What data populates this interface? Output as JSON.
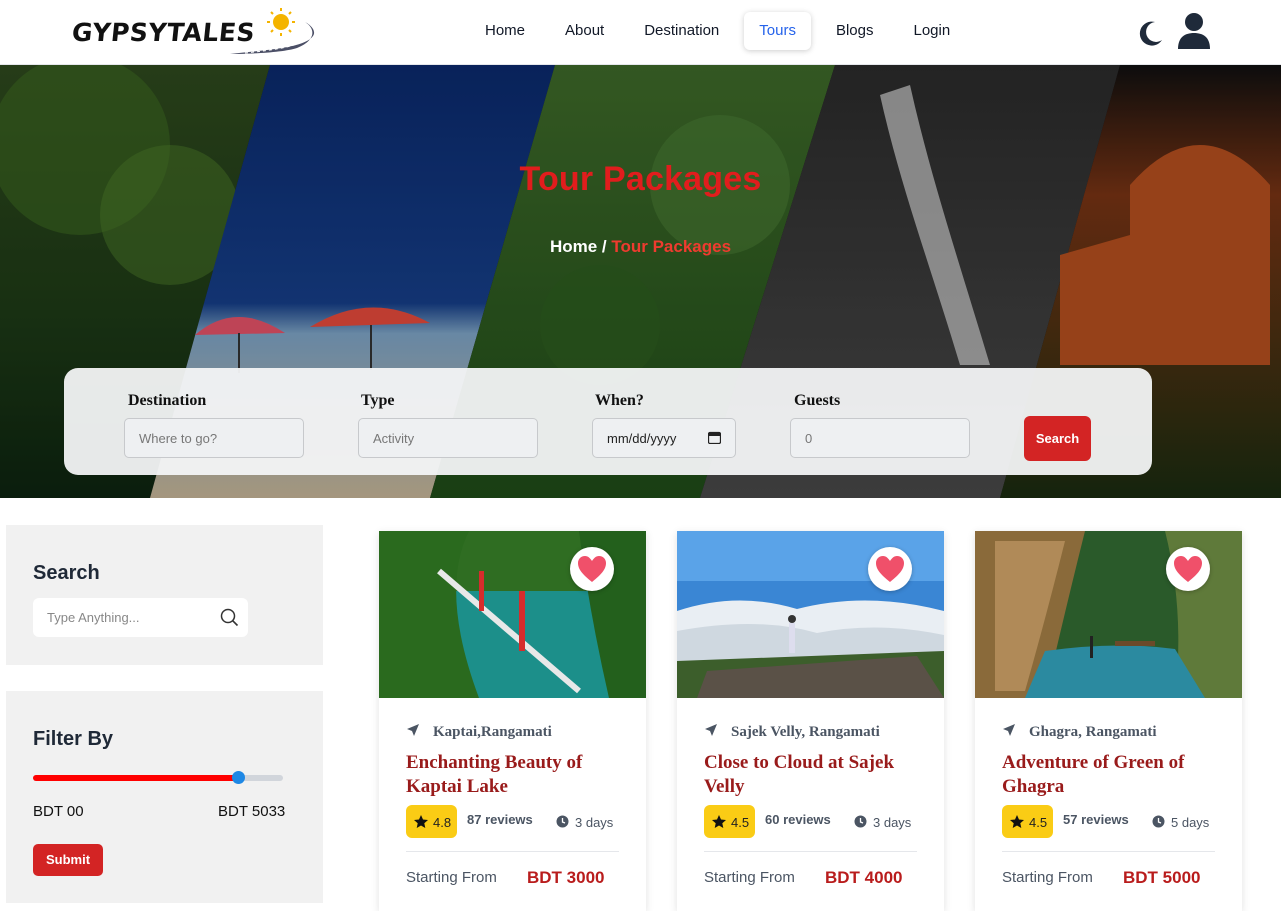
{
  "brand": {
    "name": "GYPSYTALES"
  },
  "nav": {
    "items": [
      {
        "label": "Home",
        "active": false
      },
      {
        "label": "About",
        "active": false
      },
      {
        "label": "Destination",
        "active": false
      },
      {
        "label": "Tours",
        "active": true
      },
      {
        "label": "Blogs",
        "active": false
      },
      {
        "label": "Login",
        "active": false
      }
    ],
    "icons": [
      "moon-icon",
      "user-icon"
    ]
  },
  "hero": {
    "title": "Tour Packages",
    "breadcrumb": {
      "home": "Home",
      "separator": " / ",
      "current": "Tour Packages"
    }
  },
  "search_form": {
    "destination": {
      "label": "Destination",
      "placeholder": "Where to go?"
    },
    "type": {
      "label": "Type",
      "placeholder": "Activity"
    },
    "when": {
      "label": "When?",
      "placeholder": "mm/dd/yyyy"
    },
    "guests": {
      "label": "Guests",
      "placeholder": "0"
    },
    "submit_label": "Search"
  },
  "sidebar": {
    "search": {
      "title": "Search",
      "placeholder": "Type Anything..."
    },
    "filter": {
      "title": "Filter By",
      "min_label": "BDT 00",
      "max_label": "BDT 5033",
      "slider_fraction": 0.82,
      "submit_label": "Submit"
    }
  },
  "tours": [
    {
      "location": "Kaptai,Rangamati",
      "title": "Enchanting Beauty of Kaptai Lake",
      "rating": "4.8",
      "reviews": "87 reviews",
      "duration": "3 days",
      "from_label": "Starting From",
      "price": "BDT 3000"
    },
    {
      "location": "Sajek Velly, Rangamati",
      "title": "Close to Cloud at Sajek Velly",
      "rating": "4.5",
      "reviews": "60 reviews",
      "duration": "3 days",
      "from_label": "Starting From",
      "price": "BDT 4000"
    },
    {
      "location": "Ghagra, Rangamati",
      "title": "Adventure of Green of Ghagra",
      "rating": "4.5",
      "reviews": "57 reviews",
      "duration": "5 days",
      "from_label": "Starting From",
      "price": "BDT 5000"
    }
  ],
  "colors": {
    "accent_red": "#d32424",
    "title_red": "#991b1b",
    "active_blue": "#2563eb",
    "rating_yellow": "#facc15",
    "slider_red": "#ff0000",
    "slider_knob": "#1e88e5"
  }
}
